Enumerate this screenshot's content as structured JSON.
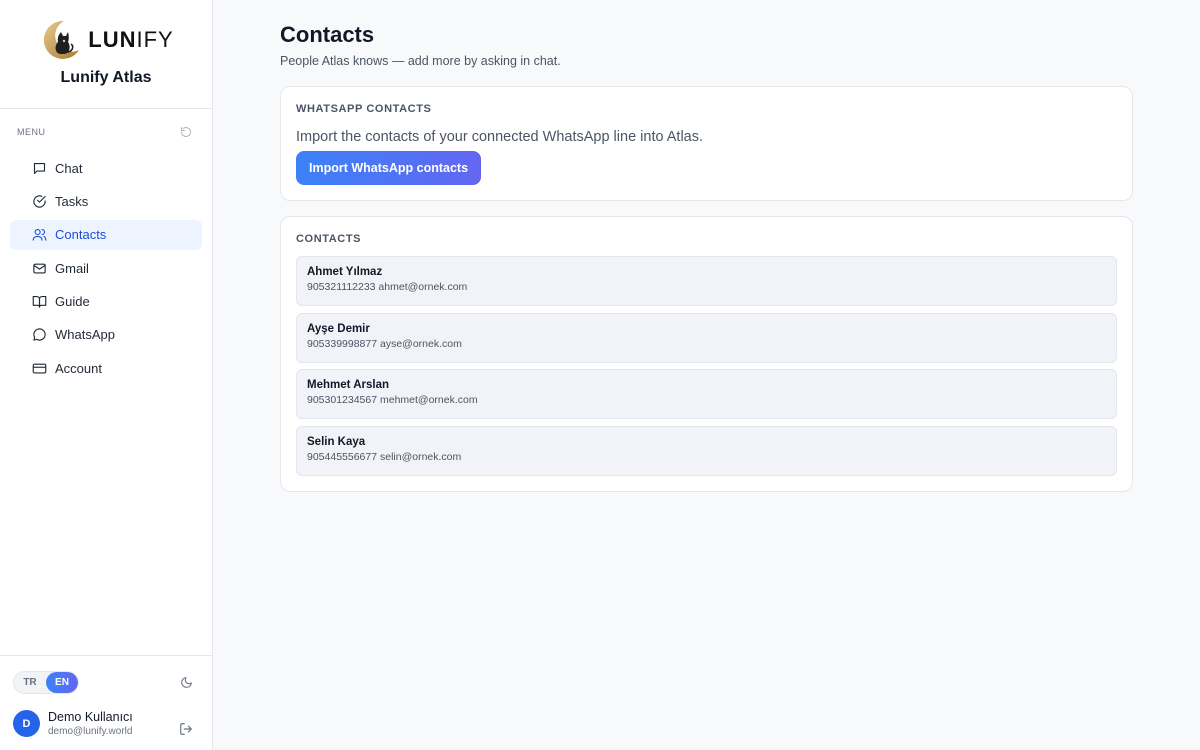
{
  "brand": {
    "logo_text_bold": "LUN",
    "logo_text_thin": "IFY",
    "app_name": "Lunify Atlas"
  },
  "sidebar": {
    "menu_label": "MENU",
    "items": [
      {
        "label": "Chat",
        "icon": "chat-icon",
        "active": false
      },
      {
        "label": "Tasks",
        "icon": "check-circle-icon",
        "active": false
      },
      {
        "label": "Contacts",
        "icon": "users-icon",
        "active": true
      },
      {
        "label": "Gmail",
        "icon": "mail-icon",
        "active": false
      },
      {
        "label": "Guide",
        "icon": "book-icon",
        "active": false
      },
      {
        "label": "WhatsApp",
        "icon": "message-circle-icon",
        "active": false
      },
      {
        "label": "Account",
        "icon": "credit-card-icon",
        "active": false
      }
    ],
    "languages": [
      {
        "label": "TR",
        "active": false
      },
      {
        "label": "EN",
        "active": true
      }
    ],
    "user": {
      "initial": "D",
      "name": "Demo Kullanıcı",
      "email": "demo@lunify.world"
    }
  },
  "main": {
    "title": "Contacts",
    "subtitle": "People Atlas knows — add more by asking in chat.",
    "whatsapp_card": {
      "title": "WHATSAPP CONTACTS",
      "text": "Import the contacts of your connected WhatsApp line into Atlas.",
      "button_label": "Import WhatsApp contacts"
    },
    "contacts_card": {
      "title": "CONTACTS",
      "contacts": [
        {
          "name": "Ahmet Yılmaz",
          "meta": "905321112233 ahmet@ornek.com"
        },
        {
          "name": "Ayşe Demir",
          "meta": "905339998877 ayse@ornek.com"
        },
        {
          "name": "Mehmet Arslan",
          "meta": "905301234567 mehmet@ornek.com"
        },
        {
          "name": "Selin Kaya",
          "meta": "905445556677 selin@ornek.com"
        }
      ]
    }
  },
  "colors": {
    "accent": "#3b82f6",
    "accent_end": "#6366f1",
    "active_nav_bg": "#eef4ff",
    "active_nav_text": "#1d4ed8"
  }
}
